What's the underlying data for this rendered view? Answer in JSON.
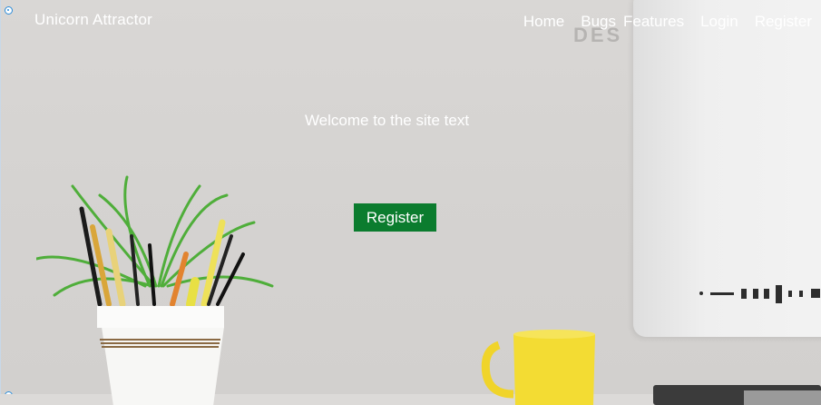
{
  "brand": "Unicorn Attractor",
  "nav": [
    "Home",
    "Bugs",
    "Features",
    "Login",
    "Register"
  ],
  "hero": {
    "text": "Welcome to the site text",
    "button": "Register"
  },
  "colors": {
    "cta_background": "#0b7c2e",
    "text": "#ffffff"
  }
}
